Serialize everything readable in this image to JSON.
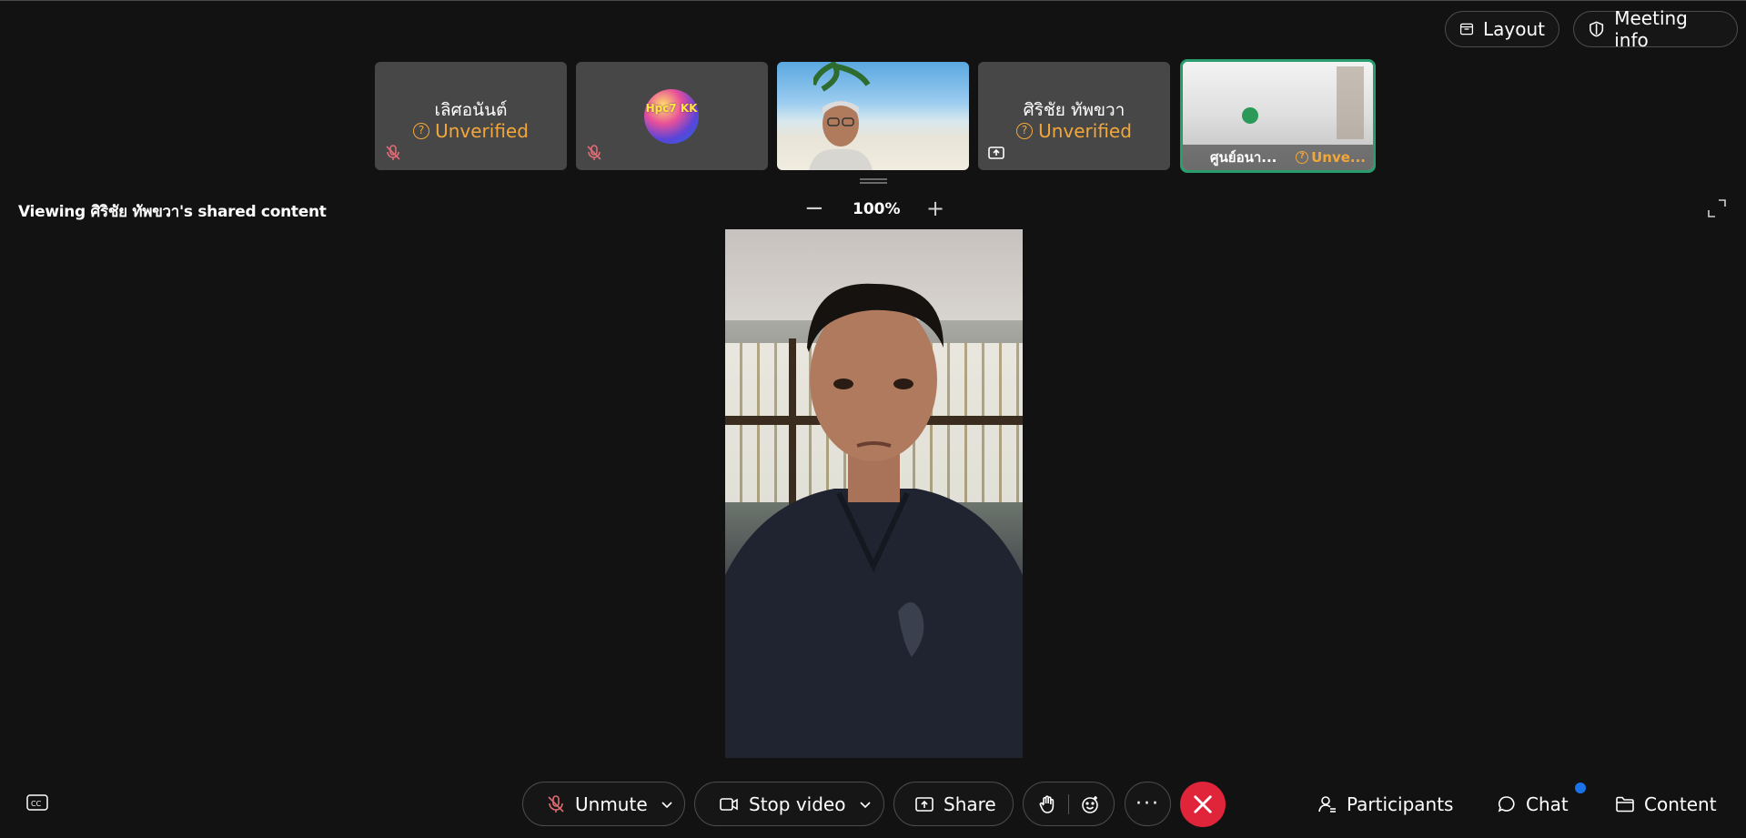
{
  "header": {
    "layout_label": "Layout",
    "meeting_info_label": "Meeting info"
  },
  "participants": [
    {
      "name": "เลิศอนันต์",
      "status": "Unverified",
      "muted": true
    },
    {
      "name": "",
      "avatar_text": "Hpc7 KK",
      "muted": true
    },
    {
      "name": "",
      "video": true
    },
    {
      "name": "ศิริชัย ทัพขวา",
      "status": "Unverified",
      "sharing": true
    },
    {
      "name": "ศูนย์อนา...",
      "status": "Unve...",
      "video": true,
      "active": true
    }
  ],
  "viewer": {
    "title": "Viewing ศิริชัย ทัพขวา's shared content",
    "zoom_minus": "−",
    "zoom_level": "100%",
    "zoom_plus": "+"
  },
  "toolbar": {
    "unmute_label": "Unmute",
    "video_label": "Stop video",
    "share_label": "Share",
    "more_label": "···",
    "participants_label": "Participants",
    "chat_label": "Chat",
    "content_label": "Content"
  },
  "colors": {
    "background": "#121212",
    "unverified": "#f2a73b",
    "leave": "#e0243a",
    "active_border": "#2a9d6e",
    "chat_badge": "#1a73e8"
  },
  "icons": [
    "layout-icon",
    "shield-icon",
    "mic-off-icon",
    "share-screen-icon",
    "expand-icon",
    "closed-captions-icon",
    "camera-icon",
    "chevron-down-icon",
    "raise-hand-icon",
    "emoji-icon",
    "more-icon",
    "close-icon",
    "participants-icon",
    "chat-icon",
    "folder-icon"
  ]
}
